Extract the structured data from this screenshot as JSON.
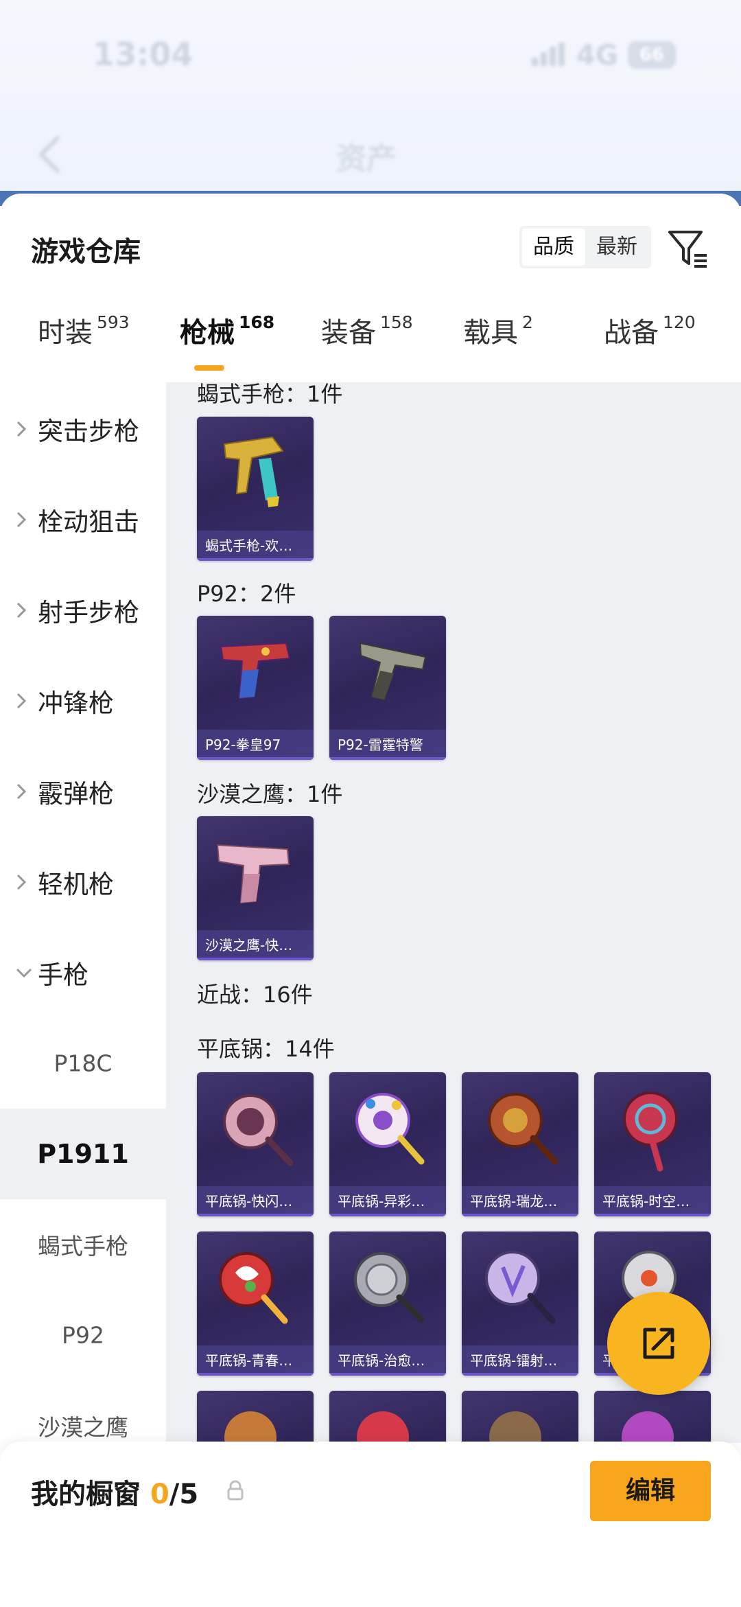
{
  "status_bar": {
    "time": "13:04",
    "network": "4G",
    "battery": "66"
  },
  "header": {
    "title": "资产"
  },
  "sheet": {
    "title": "游戏仓库",
    "sort_options": [
      "品质",
      "最新"
    ],
    "active_sort": "品质"
  },
  "tabs": [
    {
      "label": "时装",
      "count": "593"
    },
    {
      "label": "枪械",
      "count": "168"
    },
    {
      "label": "装备",
      "count": "158"
    },
    {
      "label": "载具",
      "count": "2"
    },
    {
      "label": "战备",
      "count": "120"
    }
  ],
  "active_tab": "枪械",
  "sidebar": {
    "categories": [
      {
        "label": "突击步枪",
        "expanded": false
      },
      {
        "label": "栓动狙击",
        "expanded": false
      },
      {
        "label": "射手步枪",
        "expanded": false
      },
      {
        "label": "冲锋枪",
        "expanded": false
      },
      {
        "label": "霰弹枪",
        "expanded": false
      },
      {
        "label": "轻机枪",
        "expanded": false
      },
      {
        "label": "手枪",
        "expanded": true
      }
    ],
    "subcategories": [
      "P18C",
      "P1911",
      "蝎式手枪",
      "P92",
      "沙漠之鹰"
    ],
    "selected_sub": "P1911"
  },
  "panel": {
    "sections": [
      {
        "label": "蝎式手枪：1件",
        "items": [
          "蝎式手枪-欢…"
        ]
      },
      {
        "label": "P92：2件",
        "items": [
          "P92-拳皇97",
          "P92-雷霆特警"
        ]
      },
      {
        "label": "沙漠之鹰：1件",
        "items": [
          "沙漠之鹰-快…"
        ]
      },
      {
        "label": "近战：16件",
        "items": []
      },
      {
        "label": "平底锅：14件",
        "items": [
          "平底锅-快闪…",
          "平底锅-异彩…",
          "平底锅-瑞龙…",
          "平底锅-时空…",
          "平底锅-青春…",
          "平底锅-治愈…",
          "平底锅-镭射…",
          "平底锅-…"
        ]
      }
    ]
  },
  "bottom_bar": {
    "label": "我的橱窗",
    "count": "0",
    "total": "/5",
    "edit_label": "编辑"
  },
  "colors": {
    "accent": "#f7a51c",
    "card_bg": "#2f2558",
    "panel_bg": "#eef0f4",
    "fab": "#f8b51f"
  },
  "icons": [
    "back-icon",
    "filter-icon",
    "chevron-right-icon",
    "chevron-down-icon",
    "share-icon",
    "lock-icon"
  ]
}
